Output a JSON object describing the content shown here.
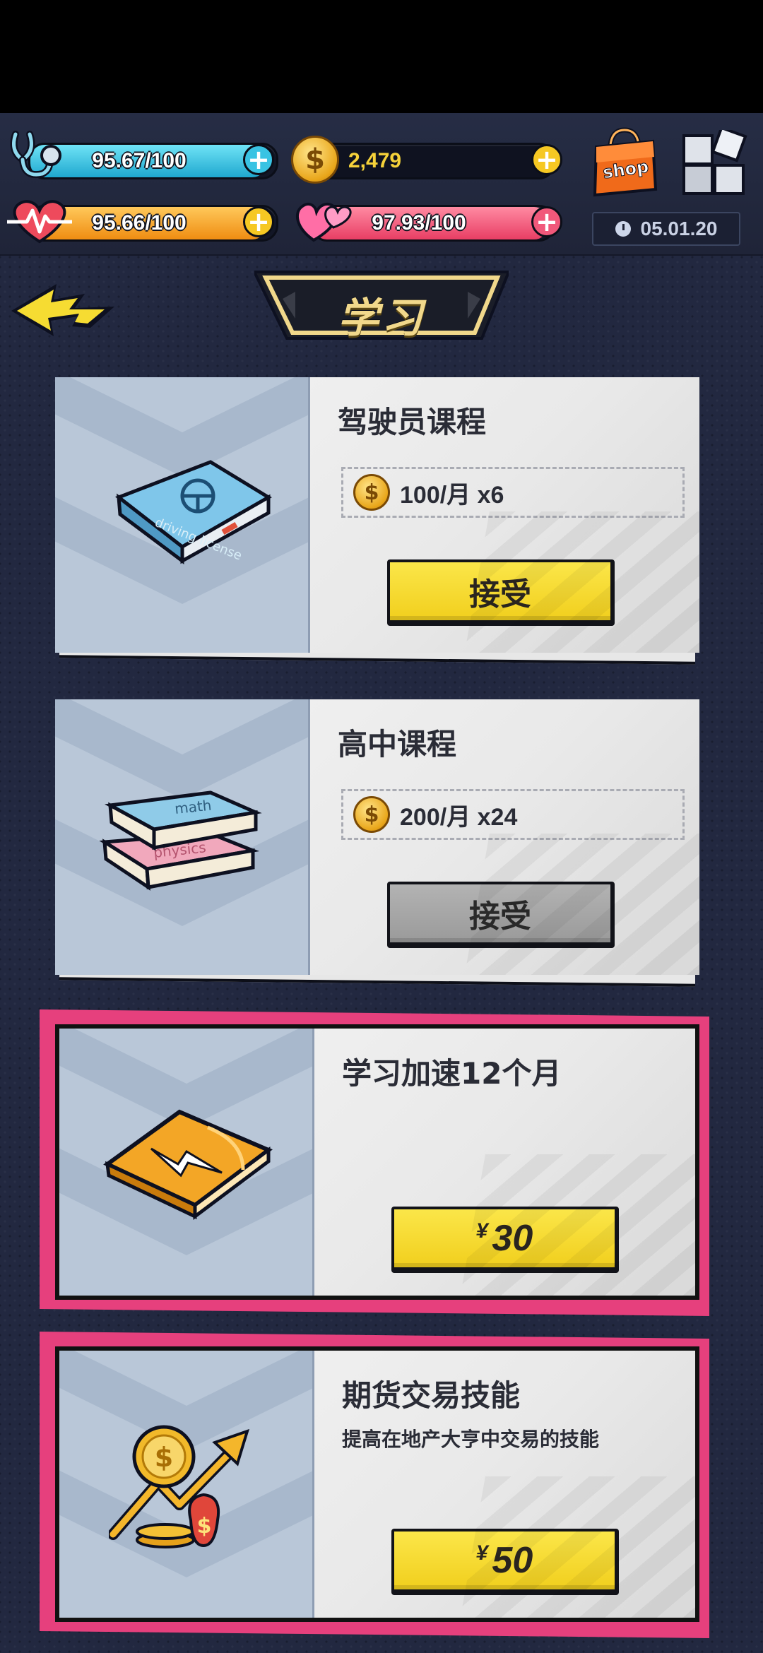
{
  "hud": {
    "health": {
      "value": "95.67/100",
      "fraction": 0.9567,
      "color": "#39c3e3"
    },
    "coins": {
      "value": "2,479"
    },
    "stamina": {
      "value": "95.66/100",
      "fraction": 0.9566,
      "color": "#f6a623"
    },
    "happiness": {
      "value": "97.93/100",
      "fraction": 0.9793,
      "color": "#f1587a"
    },
    "shop_label": "shop",
    "date": "05.01.20"
  },
  "header": {
    "title": "学习"
  },
  "cards": [
    {
      "title": "驾驶员课程",
      "art_text": "driving license",
      "price": "100/月 x6",
      "button": "接受",
      "button_state": "enabled"
    },
    {
      "title": "高中课程",
      "art_text_top": "math",
      "art_text_bottom": "physics",
      "price": "200/月 x24",
      "button": "接受",
      "button_state": "disabled"
    },
    {
      "title": "学习加速12个月",
      "currency": "¥",
      "button_price": "30"
    },
    {
      "title": "期货交易技能",
      "description": "提高在地产大亨中交易的技能",
      "currency": "¥",
      "button_price": "50"
    }
  ],
  "colors": {
    "accent_yellow": "#f6dc32",
    "pink_frame": "#e6407d",
    "background": "#222840"
  }
}
